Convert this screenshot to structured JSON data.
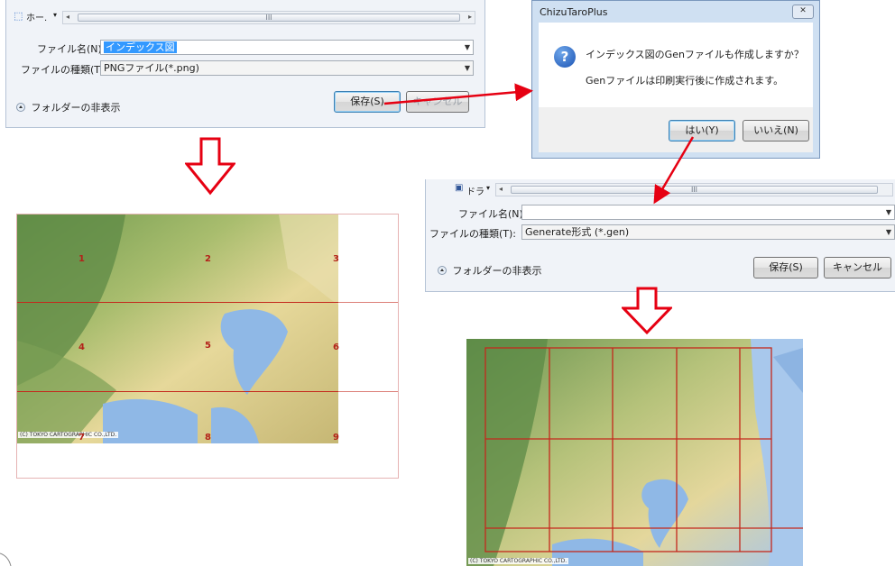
{
  "dialog1": {
    "nav_label": "ホー.",
    "scroll_mark": "III",
    "filename_label": "ファイル名(N):",
    "filename_value": "インデックス図",
    "filetype_label": "ファイルの種類(T):",
    "filetype_value": "PNGファイル(*.png)",
    "folder_toggle": "フォルダーの非表示",
    "save_button": "保存(S)",
    "cancel_button": "キャンセル"
  },
  "msgbox": {
    "title": "ChizuTaroPlus",
    "close": "✕",
    "question": "インデックス図のGenファイルも作成しますか？",
    "info": "Genファイルは印刷実行後に作成されます。",
    "yes_button": "はい(Y)",
    "no_button": "いいえ(N)"
  },
  "dialog2": {
    "nav_label": "ドラ",
    "scroll_mark": "III",
    "filename_label": "ファイル名(N):",
    "filename_value": "",
    "filetype_label": "ファイルの種類(T):",
    "filetype_value": "Generate形式 (*.gen)",
    "folder_toggle": "フォルダーの非表示",
    "save_button": "保存(S)",
    "cancel_button": "キャンセル"
  },
  "index_map": {
    "cells": [
      "1",
      "2",
      "3",
      "4",
      "5",
      "6",
      "7",
      "8",
      "9"
    ],
    "copyright": "(C) TOKYO CARTOGRAPHIC CO.,LTD."
  },
  "grid_map": {
    "copyright": "(C) TOKYO CARTOGRAPHIC CO.,LTD."
  },
  "colors": {
    "arrow_red": "#e60012",
    "grid_red": "#c4281c",
    "dialog_bg": "#f0f3f8",
    "selection_blue": "#3399ff"
  },
  "icons": [
    "question-icon",
    "close-icon",
    "folder-toggle-icon",
    "dropdown-arrow-icon",
    "hollow-down-arrow-icon"
  ]
}
